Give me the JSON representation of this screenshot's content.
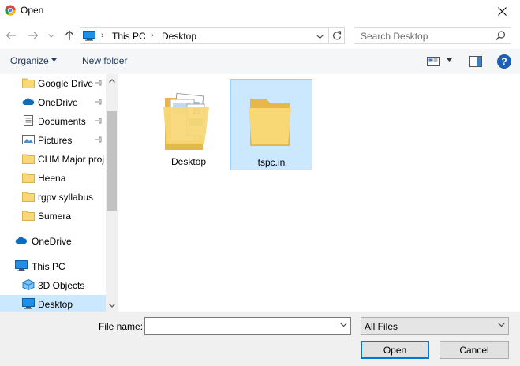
{
  "window": {
    "title": "Open",
    "title_icon": "chrome-icon",
    "close_icon": "close-icon"
  },
  "nav": {
    "back_icon": "arrow-left-icon",
    "forward_icon": "arrow-right-icon",
    "recent_icon": "chevron-down-icon",
    "up_icon": "arrow-up-icon"
  },
  "address": {
    "breadcrumbs": [
      "This PC",
      "Desktop"
    ],
    "separator": "›",
    "refresh_icon": "refresh-icon"
  },
  "search": {
    "placeholder": "Search Desktop"
  },
  "toolbar": {
    "organize_label": "Organize",
    "new_folder_label": "New folder",
    "help_label": "?"
  },
  "sidebar": {
    "items": [
      {
        "label": "Google Drive",
        "icon": "folder-icon",
        "pinned": true
      },
      {
        "label": "OneDrive",
        "icon": "cloud-icon",
        "pinned": true
      },
      {
        "label": "Documents",
        "icon": "documents-icon",
        "pinned": true
      },
      {
        "label": "Pictures",
        "icon": "pictures-icon",
        "pinned": true
      },
      {
        "label": "CHM Major proj",
        "icon": "folder-icon",
        "pinned": false
      },
      {
        "label": "Heena",
        "icon": "folder-icon",
        "pinned": false
      },
      {
        "label": "rgpv syllabus",
        "icon": "folder-icon",
        "pinned": false
      },
      {
        "label": "Sumera",
        "icon": "folder-icon",
        "pinned": false
      },
      {
        "label": "OneDrive",
        "icon": "cloud-icon",
        "pinned": false
      },
      {
        "label": "This PC",
        "icon": "computer-icon",
        "pinned": false
      },
      {
        "label": "3D Objects",
        "icon": "cube-icon",
        "pinned": false
      },
      {
        "label": "Desktop",
        "icon": "desktop-icon",
        "pinned": false,
        "selected": true
      }
    ]
  },
  "files": [
    {
      "name": "Desktop",
      "icon": "folder-with-documents-icon",
      "selected": false
    },
    {
      "name": "tspc.in",
      "icon": "folder-icon",
      "selected": true
    }
  ],
  "bottom": {
    "file_name_label": "File name:",
    "file_name_value": "",
    "filter_value": "All Files",
    "open_label": "Open",
    "cancel_label": "Cancel"
  },
  "colors": {
    "accent": "#0078d7",
    "selection": "#cce8ff",
    "folder": "#f8d775",
    "link_text": "#1e395b"
  }
}
